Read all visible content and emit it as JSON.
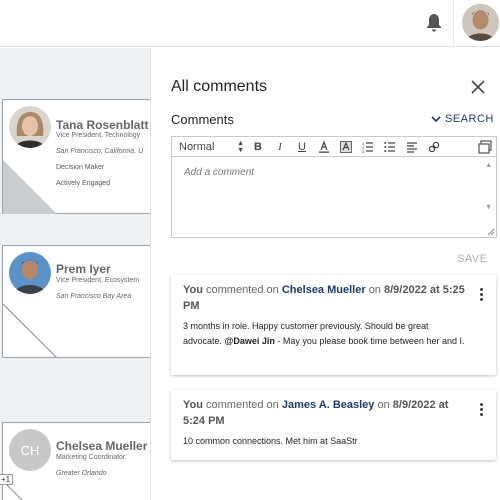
{
  "topbar": {
    "bell_icon": "bell-icon",
    "avatar_icon": "user-avatar"
  },
  "canvas": {
    "cards": [
      {
        "name": "Tana Rosenblatt",
        "title": "Vice President, Technology",
        "location": "San Francisco, California, U",
        "tags": [
          "Decision Maker",
          "Actively Engaged"
        ]
      },
      {
        "name": "Prem Iyer",
        "title": "Vice President, Ecosystem",
        "location": "San Francisco Bay Area",
        "tags": []
      },
      {
        "name": "Chelsea Mueller",
        "initials": "CH",
        "title": "Marketing Coordinator",
        "location": "Greater Orlando",
        "tags": []
      }
    ],
    "badge": "+1"
  },
  "panel": {
    "title": "All comments",
    "comments_label": "Comments",
    "search_label": "SEARCH",
    "editor": {
      "format_value": "Normal",
      "placeholder": "Add a comment",
      "toolbar_icons": [
        "bold-icon",
        "italic-icon",
        "underline-icon",
        "text-color-icon",
        "highlight-icon",
        "ordered-list-icon",
        "bullet-list-icon",
        "align-icon",
        "link-icon",
        "fullscreen-icon"
      ]
    },
    "save_label": "SAVE",
    "comments": [
      {
        "author": "You",
        "verb": "commented on",
        "person": "Chelsea Mueller",
        "on": "on",
        "date": "8/9/2022 at 5:25 PM",
        "body_before": "3 months in role. Happy customer previously. Should be great advocate.",
        "mention": "@Dawei Jin",
        "body_after": " - May you please book time between her and I."
      },
      {
        "author": "You",
        "verb": "commented on",
        "person": "James A. Beasley",
        "on": "on",
        "date": "8/9/2022 at 5:24 PM",
        "body_before": "10 common connections. Met him at SaaStr",
        "mention": "",
        "body_after": ""
      }
    ]
  }
}
